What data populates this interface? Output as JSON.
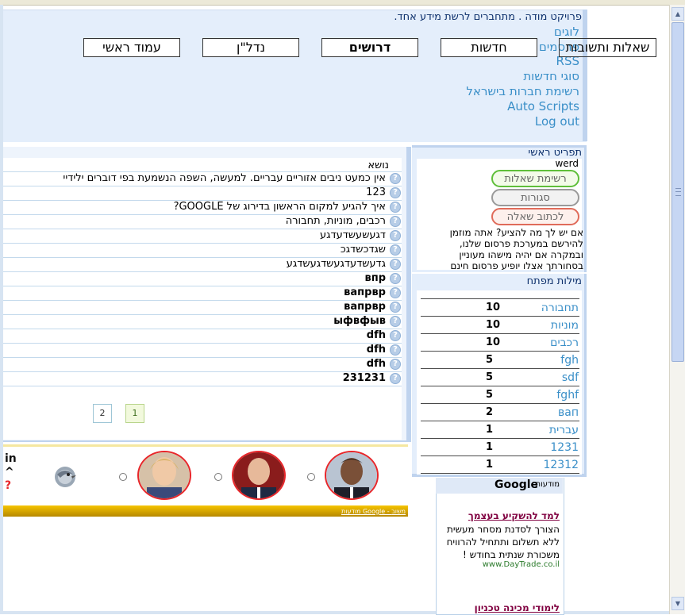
{
  "header": {
    "tagline": "פרויקט מודה . מתחברים לרשת מידע אחד.",
    "links": [
      "לוגים",
      "פרסמים",
      "RSS",
      "סוגי חדשות",
      "רשימת חברות בישראל",
      "Auto Scripts",
      "Log out"
    ],
    "nav_buttons": [
      "שאלות ותשובות",
      "חדשות",
      "דרושים",
      "נדל\"ן",
      "עמוד ראשי"
    ]
  },
  "topics": {
    "column_header": "נושא",
    "rows": [
      "אין כמעט ניבים אזוריים עבריים. למעשה, השפה הנשמעת בפי דוברים ילידיי",
      "123",
      "איך להגיע למקום הראשון בדירוג של GOOGLE?",
      "רכבים, מוניות, תחבורה",
      "דגעשעשדעדגע",
      "שגדכשדגכ",
      "גדעשדעדגעשדגעשדגע",
      "впр",
      "вапрвр",
      "вапрвр",
      "ыфвфыв",
      "dfh",
      "dfh",
      "dfh",
      "231231"
    ],
    "pages": [
      "1",
      "2"
    ],
    "current_page": "1"
  },
  "side_menu": {
    "title": "תפריט ראשי",
    "user": "werd",
    "buttons": [
      "רשימת שאלות",
      "סגורות",
      "לכתוב שאלה"
    ],
    "text": "אם יש לך מה להציע? אתה מוזמן להירשם במערכת פרסום שלנו, ובמקרה אם יהיה מישהו מעוניין בסחורתך אצלו יופיע פרסום חינם"
  },
  "keywords": {
    "title": "מילות מפתח",
    "items": [
      {
        "word": "תחבורה",
        "count": "10"
      },
      {
        "word": "מוניות",
        "count": "10"
      },
      {
        "word": "רכבים",
        "count": "10"
      },
      {
        "word": "fgh",
        "count": "5"
      },
      {
        "word": "sdf",
        "count": "5"
      },
      {
        "word": "fghf",
        "count": "5"
      },
      {
        "word": "вап",
        "count": "2"
      },
      {
        "word": "עברית",
        "count": "1"
      },
      {
        "word": "1231",
        "count": "1"
      },
      {
        "word": "12312",
        "count": "1"
      }
    ]
  },
  "banner": {
    "ad_label": "מודעות Google - משוב",
    "letters": "in\n^\n?"
  },
  "google_ads": {
    "label": "מודעות",
    "brand": "Google",
    "ad1_title": "למד להשקיע בעצמך",
    "ad1_body": "הצורך לסדנת מסחר מעשית ללא תשלום ותתחיל להרוויח משכורת שנתית בחודש !",
    "ad1_url": "www.DayTrade.co.il",
    "ad2_title": "לימודי מכינה טכניון"
  },
  "colors": {
    "panel_bg": "#e4eefb",
    "panel_border": "#bfd3ee",
    "link": "#3a8fc8",
    "title": "#0c2f6b",
    "pill_green": "#5fbf3a",
    "pill_gray": "#9a9a9a",
    "pill_red": "#e06b5a"
  }
}
